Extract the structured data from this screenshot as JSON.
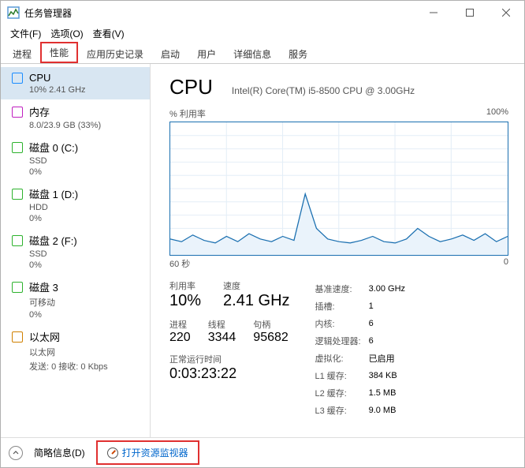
{
  "window": {
    "title": "任务管理器"
  },
  "menu": {
    "file": "文件(F)",
    "options": "选项(O)",
    "view": "查看(V)"
  },
  "tabs": {
    "items": [
      "进程",
      "性能",
      "应用历史记录",
      "启动",
      "用户",
      "详细信息",
      "服务"
    ],
    "active_index": 1
  },
  "sidebar": {
    "items": [
      {
        "name": "CPU",
        "sub": "10% 2.41 GHz",
        "color": "#1a8cff",
        "selected": true
      },
      {
        "name": "内存",
        "sub": "8.0/23.9 GB (33%)",
        "color": "#c020c0",
        "selected": false
      },
      {
        "name": "磁盘 0 (C:)",
        "sub": "SSD",
        "sub2": "0%",
        "color": "#2db22d",
        "selected": false
      },
      {
        "name": "磁盘 1 (D:)",
        "sub": "HDD",
        "sub2": "0%",
        "color": "#2db22d",
        "selected": false
      },
      {
        "name": "磁盘 2 (F:)",
        "sub": "SSD",
        "sub2": "0%",
        "color": "#2db22d",
        "selected": false
      },
      {
        "name": "磁盘 3",
        "sub": "可移动",
        "sub2": "0%",
        "color": "#2db22d",
        "selected": false
      },
      {
        "name": "以太网",
        "sub": "以太网",
        "sub2": "发送: 0 接收: 0 Kbps",
        "color": "#d08000",
        "selected": false
      }
    ]
  },
  "main": {
    "title": "CPU",
    "subtitle": "Intel(R) Core(TM) i5-8500 CPU @ 3.00GHz",
    "chart_top_left": "% 利用率",
    "chart_top_right": "100%",
    "chart_bottom_left": "60 秒",
    "chart_bottom_right": "0",
    "labels": {
      "utilization": "利用率",
      "speed": "速度",
      "processes": "进程",
      "threads": "线程",
      "handles": "句柄",
      "uptime": "正常运行时间"
    },
    "values": {
      "utilization": "10%",
      "speed": "2.41 GHz",
      "processes": "220",
      "threads": "3344",
      "handles": "95682",
      "uptime": "0:03:23:22"
    },
    "right_rows": [
      {
        "k": "基准速度:",
        "v": "3.00 GHz"
      },
      {
        "k": "插槽:",
        "v": "1"
      },
      {
        "k": "内核:",
        "v": "6"
      },
      {
        "k": "逻辑处理器:",
        "v": "6"
      },
      {
        "k": "虚拟化:",
        "v": "已启用"
      },
      {
        "k": "L1 缓存:",
        "v": "384 KB"
      },
      {
        "k": "L2 缓存:",
        "v": "1.5 MB"
      },
      {
        "k": "L3 缓存:",
        "v": "9.0 MB"
      }
    ]
  },
  "footer": {
    "fewer": "简略信息(D)",
    "resmon": "打开资源监视器"
  },
  "chart_data": {
    "type": "line",
    "title": "% 利用率",
    "ylabel": "%",
    "ylim": [
      0,
      100
    ],
    "xlabel": "秒",
    "xlim": [
      60,
      0
    ],
    "x": [
      60,
      58,
      56,
      54,
      52,
      50,
      48,
      46,
      44,
      42,
      40,
      38,
      36,
      34,
      32,
      30,
      28,
      26,
      24,
      22,
      20,
      18,
      16,
      14,
      12,
      10,
      8,
      6,
      4,
      2,
      0
    ],
    "values": [
      12,
      10,
      15,
      11,
      9,
      14,
      10,
      16,
      12,
      10,
      14,
      11,
      46,
      20,
      12,
      10,
      9,
      11,
      14,
      10,
      9,
      12,
      20,
      14,
      10,
      12,
      15,
      11,
      16,
      10,
      14
    ]
  }
}
